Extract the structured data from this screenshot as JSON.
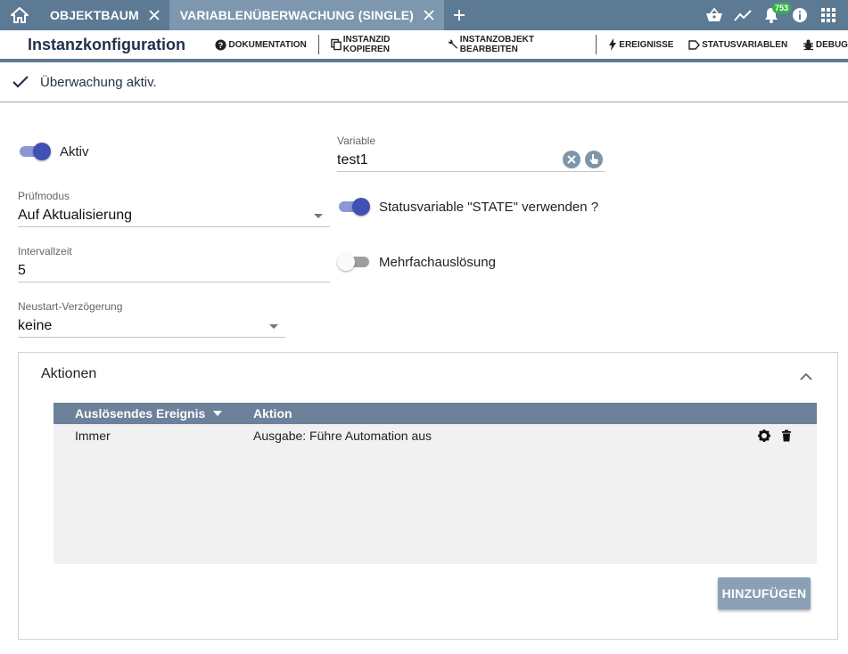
{
  "tabs": [
    {
      "label": "OBJEKTBAUM",
      "active": false
    },
    {
      "label": "VARIABLENÜBERWACHUNG (SINGLE)",
      "active": true
    }
  ],
  "notifications": {
    "count": "753"
  },
  "toolbar": {
    "title": "Instanzkonfiguration",
    "documentation": "DOKUMENTATION",
    "copy_instance_id": "INSTANZID KOPIEREN",
    "edit_instance_object": "INSTANZOBJEKT BEARBEITEN",
    "events": "EREIGNISSE",
    "status_variables": "STATUSVARIABLEN",
    "debug": "DEBUG"
  },
  "status": {
    "text": "Überwachung aktiv."
  },
  "form": {
    "active": {
      "label": "Aktiv",
      "on": true
    },
    "check_mode": {
      "label": "Prüfmodus",
      "value": "Auf Aktualisierung"
    },
    "interval": {
      "label": "Intervallzeit",
      "value": "5"
    },
    "restart_delay": {
      "label": "Neustart-Verzögerung",
      "value": "keine"
    },
    "variable": {
      "label": "Variable",
      "value": "test1"
    },
    "use_state": {
      "label": "Statusvariable \"STATE\" verwenden ?",
      "on": true
    },
    "multi_trigger": {
      "label": "Mehrfachauslösung",
      "on": false
    }
  },
  "actions": {
    "title": "Aktionen",
    "columns": [
      "Auslösendes Ereignis",
      "Aktion"
    ],
    "rows": [
      {
        "event": "Immer",
        "action": "Ausgabe: Führe Automation aus"
      }
    ],
    "add_label": "HINZUFÜGEN"
  },
  "colors": {
    "header": "#5d7a94",
    "active_tab": "#7c97ae",
    "toggle_on": "#3f51b5",
    "table_header": "#6c819a",
    "add_button": "#8ba0b4"
  }
}
